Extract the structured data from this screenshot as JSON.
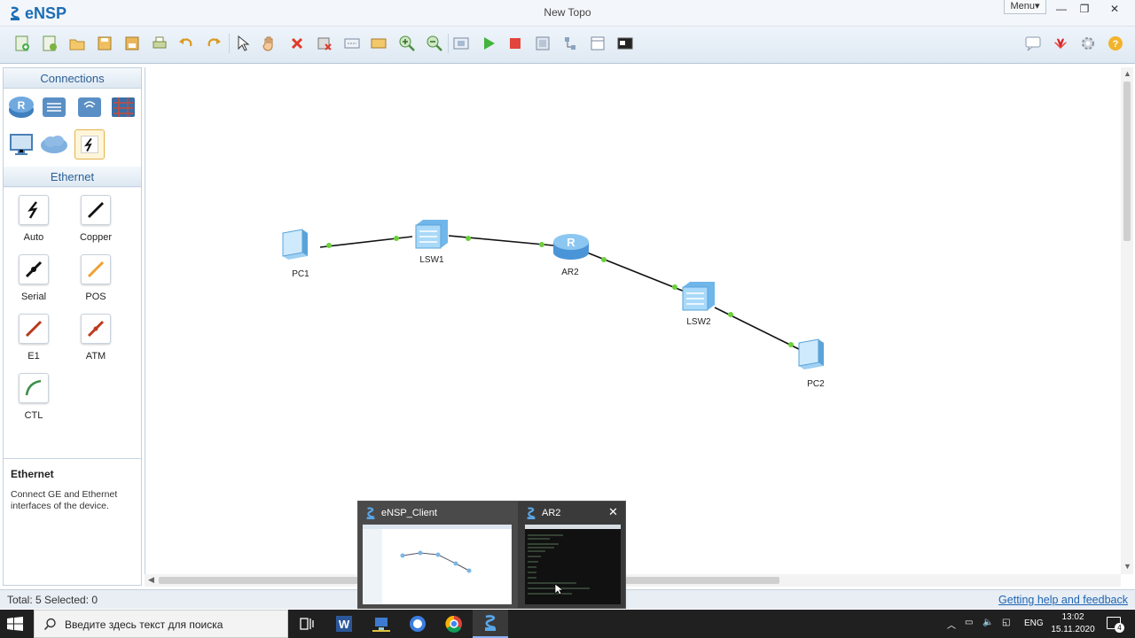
{
  "app": {
    "logo": "eNSP",
    "window_title": "New Topo",
    "menu_label": "Menu"
  },
  "toolbar": {
    "buttons": [
      "new",
      "new-example",
      "open",
      "save",
      "save-as",
      "print",
      "undo",
      "redo",
      "select",
      "pan",
      "delete",
      "delete-connections",
      "add-text",
      "add-shape",
      "zoom-in",
      "zoom-out",
      "fit",
      "start",
      "stop",
      "capture",
      "topology",
      "grid",
      "console"
    ],
    "right_buttons": [
      "forum",
      "huawei",
      "settings",
      "help"
    ]
  },
  "left_panel": {
    "section1": "Connections",
    "section2": "Ethernet",
    "devices": [
      "router-icon",
      "switch-icon",
      "wlan-icon",
      "firewall-icon",
      "pc-icon",
      "cloud-icon",
      "cable-icon"
    ],
    "cables": [
      {
        "label": "Auto",
        "color": "#222222"
      },
      {
        "label": "Copper",
        "color": "#111111"
      },
      {
        "label": "Serial",
        "color": "#111111"
      },
      {
        "label": "POS",
        "color": "#f0a030"
      },
      {
        "label": "E1",
        "color": "#b8381c"
      },
      {
        "label": "ATM",
        "color": "#c0391e"
      },
      {
        "label": "CTL",
        "color": "#3a8f4a"
      }
    ],
    "desc_title": "Ethernet",
    "desc_text": "Connect GE and Ethernet interfaces of the device."
  },
  "topology": {
    "nodes": [
      "PC1",
      "LSW1",
      "AR2",
      "LSW2",
      "PC2"
    ]
  },
  "status": {
    "left": "Total: 5  Selected: 0",
    "help": "Getting help and feedback"
  },
  "popup": {
    "item1": "eNSP_Client",
    "item2": "AR2"
  },
  "taskbar": {
    "search_placeholder": "Введите здесь текст для поиска",
    "lang": "ENG",
    "time": "13:02",
    "date": "15.11.2020",
    "notification_count": "4"
  }
}
